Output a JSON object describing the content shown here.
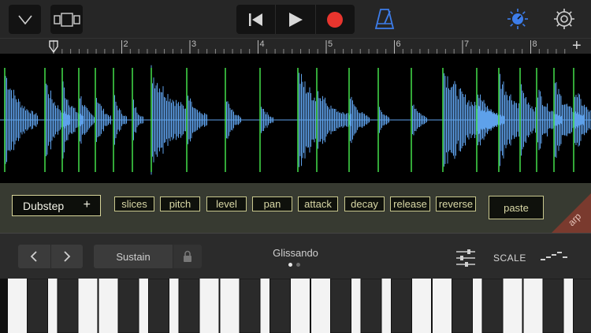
{
  "toolbar": {
    "icons": [
      "browser-dropdown-icon",
      "view-toggle-icon",
      "go-to-beginning-icon",
      "play-icon",
      "record-icon",
      "metronome-icon",
      "master-effects-icon",
      "settings-icon"
    ],
    "record_color": "#e8352e",
    "metronome_color": "#3d7dea",
    "add_track_label": "+"
  },
  "ruler": {
    "bars": [
      "2",
      "3",
      "4",
      "5",
      "6",
      "7",
      "8"
    ]
  },
  "waveform": {
    "wave_color": "#5ea1ea",
    "slice_marker_color": "#44e04a",
    "slice_count": 27
  },
  "controls": {
    "preset_label": "Dubstep",
    "preset_add": "+",
    "chips": [
      "slices",
      "pitch",
      "level",
      "pan",
      "attack",
      "decay",
      "release",
      "reverse"
    ],
    "paste_label": "paste",
    "arp_label": "arp",
    "accent": "#c9c88e",
    "arp_color": "#7a3a2e"
  },
  "keyboard": {
    "octave_down": "‹",
    "octave_up": "›",
    "sustain_label": "Sustain",
    "mode_label": "Glissando",
    "page_indicator": {
      "count": 2,
      "active": 0
    },
    "scale_label": "SCALE"
  }
}
